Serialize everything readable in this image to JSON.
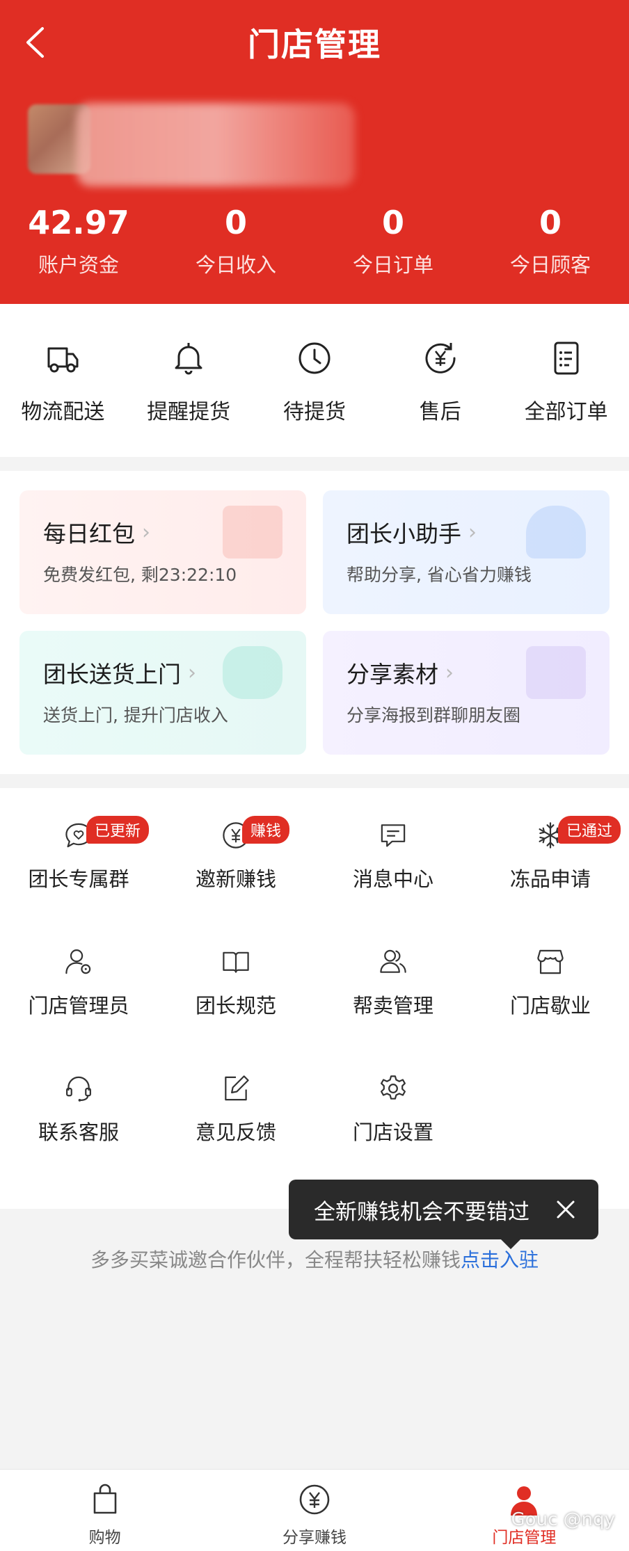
{
  "header": {
    "title": "门店管理",
    "stats": [
      {
        "value": "42.97",
        "label": "账户资金"
      },
      {
        "value": "0",
        "label": "今日收入"
      },
      {
        "value": "0",
        "label": "今日订单"
      },
      {
        "value": "0",
        "label": "今日顾客"
      }
    ]
  },
  "quick_actions": [
    {
      "label": "物流配送",
      "icon": "truck-icon"
    },
    {
      "label": "提醒提货",
      "icon": "bell-icon"
    },
    {
      "label": "待提货",
      "icon": "clock-icon"
    },
    {
      "label": "售后",
      "icon": "refund-icon"
    },
    {
      "label": "全部订单",
      "icon": "order-list-icon"
    }
  ],
  "cards": [
    {
      "title": "每日红包",
      "subtitle": "免费发红包, 剩23:22:10"
    },
    {
      "title": "团长小助手",
      "subtitle": "帮助分享, 省心省力赚钱"
    },
    {
      "title": "团长送货上门",
      "subtitle": "送货上门, 提升门店收入"
    },
    {
      "title": "分享素材",
      "subtitle": "分享海报到群聊朋友圈"
    }
  ],
  "tools": [
    {
      "label": "团长专属群",
      "icon": "chat-heart-icon",
      "badge": "已更新"
    },
    {
      "label": "邀新赚钱",
      "icon": "yuan-icon",
      "badge": "赚钱"
    },
    {
      "label": "消息中心",
      "icon": "message-icon"
    },
    {
      "label": "冻品申请",
      "icon": "snowflake-icon",
      "badge": "已通过"
    },
    {
      "label": "门店管理员",
      "icon": "admin-icon"
    },
    {
      "label": "团长规范",
      "icon": "book-icon"
    },
    {
      "label": "帮卖管理",
      "icon": "users-icon"
    },
    {
      "label": "门店歇业",
      "icon": "store-icon"
    },
    {
      "label": "联系客服",
      "icon": "headset-icon"
    },
    {
      "label": "意见反馈",
      "icon": "edit-icon"
    },
    {
      "label": "门店设置",
      "icon": "gear-icon"
    }
  ],
  "toast": {
    "text": "全新赚钱机会不要错过"
  },
  "invite": {
    "text": "多多买菜诚邀合作伙伴，全程帮扶轻松赚钱",
    "link": "点击入驻"
  },
  "tabbar": [
    {
      "label": "购物",
      "icon": "bag-icon"
    },
    {
      "label": "分享赚钱",
      "icon": "yuan-circle-icon"
    },
    {
      "label": "门店管理",
      "icon": "user-icon",
      "active": true
    }
  ],
  "watermark": "Gouc @nqy",
  "colors": {
    "brand_red": "#e02e24",
    "link_blue": "#2a6fdb"
  }
}
